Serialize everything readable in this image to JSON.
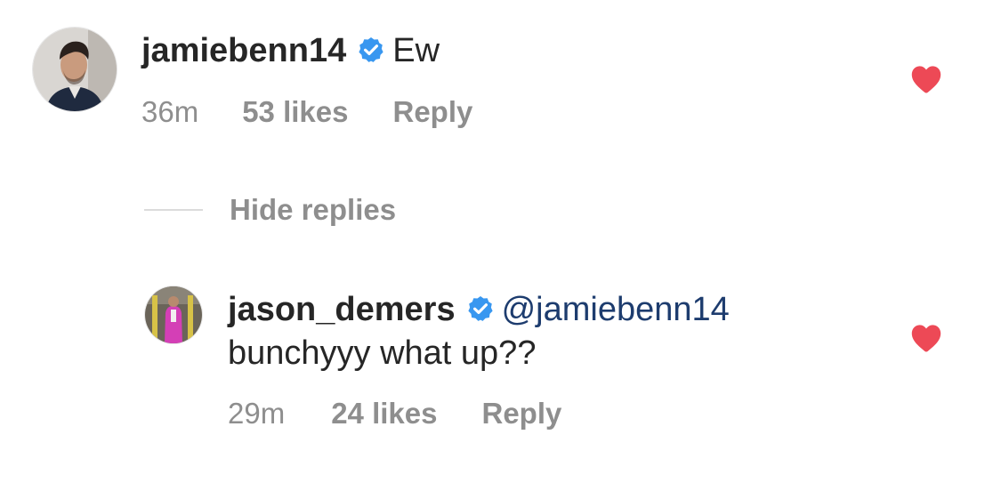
{
  "comments": [
    {
      "username": "jamiebenn14",
      "verified": true,
      "text": "Ew",
      "time": "36m",
      "likes": "53 likes",
      "reply_label": "Reply",
      "liked": true
    },
    {
      "username": "jason_demers",
      "verified": true,
      "mention": "@jamiebenn14",
      "text": "bunchyyy what up??",
      "time": "29m",
      "likes": "24 likes",
      "reply_label": "Reply",
      "liked": true
    }
  ],
  "replies_toggle": {
    "label": "Hide replies"
  },
  "colors": {
    "heart": "#ed4956",
    "verified": "#3897f0",
    "secondary_text": "#8e8e8e",
    "primary_text": "#262626",
    "mention": "#1d3c6e"
  },
  "icons": {
    "verified": "verified-badge-icon",
    "like": "heart-icon"
  }
}
